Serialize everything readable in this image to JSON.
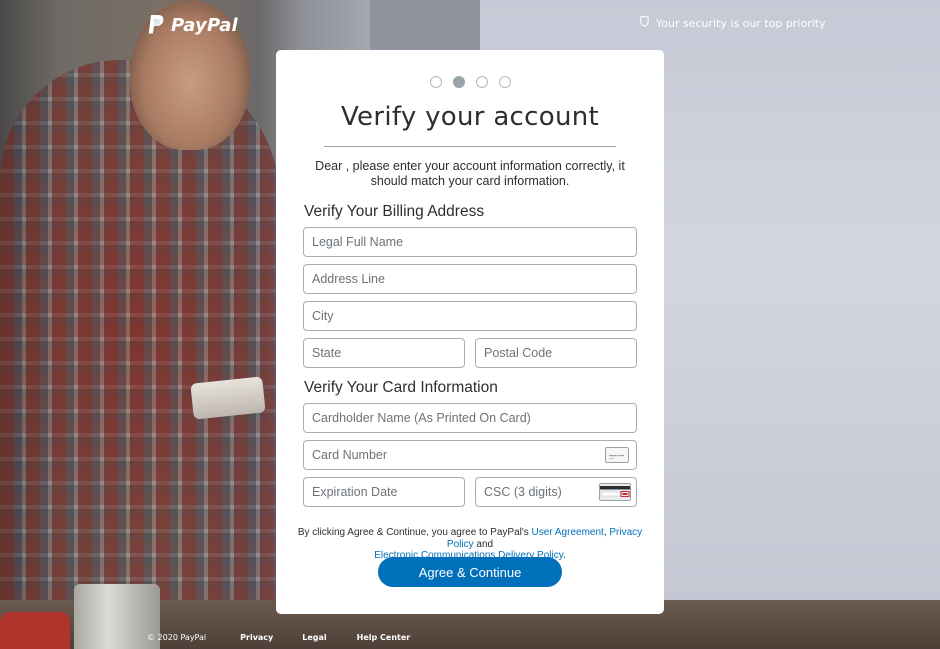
{
  "header": {
    "brand": "PayPal",
    "security_text": "Your security is our top priority"
  },
  "steps": {
    "count": 4,
    "active": 2
  },
  "card": {
    "title": "Verify your account",
    "intro": "Dear , please enter your account information correctly, it should match your card information.",
    "billing": {
      "heading": "Verify Your Billing Address",
      "full_name_placeholder": "Legal Full Name",
      "address_placeholder": "Address Line",
      "city_placeholder": "City",
      "state_placeholder": "State",
      "postal_placeholder": "Postal Code"
    },
    "payment": {
      "heading": "Verify Your Card Information",
      "cardholder_placeholder": "Cardholder Name (As Printed On Card)",
      "card_number_placeholder": "Card Number",
      "expiration_placeholder": "Expiration Date",
      "csc_placeholder": "CSC (3 digits)",
      "card_number_icon": "credit-card-front-icon",
      "csc_icon": "credit-card-back-icon"
    },
    "legal": {
      "prefix": "By clicking Agree & Continue, you agree to PayPal's",
      "user_agreement": "User Agreement",
      "comma": ",",
      "privacy_policy": "Privacy Policy",
      "and": "and",
      "ecd_policy": "Electronic Communications Delivery Policy",
      "period": "."
    },
    "submit_label": "Agree & Continue"
  },
  "footer": {
    "copyright": "© 2020 PayPal",
    "privacy": "Privacy",
    "legal": "Legal",
    "help": "Help Center"
  },
  "colors": {
    "accent": "#0070ba",
    "step_active": "#9aa5ab",
    "text": "#2c2e2f"
  }
}
